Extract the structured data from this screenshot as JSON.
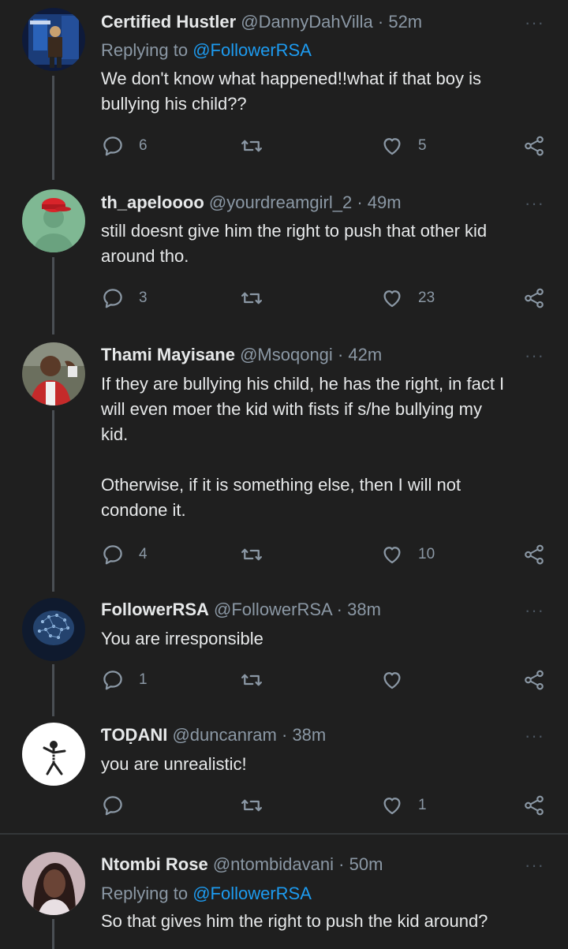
{
  "tweets": [
    {
      "name": "Certified Hustler",
      "handle": "@DannyDahVilla",
      "sep": "·",
      "time": "52m",
      "replying_prefix": "Replying to",
      "replying_to": "@FollowerRSA",
      "text": "We don't know what happened!!what if that boy is\nbullying his child??",
      "replies": "6",
      "retweets": "",
      "likes": "5"
    },
    {
      "name": "th_apeloooo",
      "handle": "@yourdreamgirl_2",
      "sep": "·",
      "time": "49m",
      "text": "still doesnt give him the right to push that other kid\naround tho.",
      "replies": "3",
      "retweets": "",
      "likes": "23"
    },
    {
      "name": "Thami Mayisane",
      "handle": "@Msoqongi",
      "sep": "·",
      "time": "42m",
      "text": "If they are bullying his child, he has the right, in fact I\nwill even moer the kid with fists if s/he bullying my\nkid.\n\nOtherwise, if it is something else, then I will not\ncondone it.",
      "replies": "4",
      "retweets": "",
      "likes": "10"
    },
    {
      "name": "FollowerRSA",
      "handle": "@FollowerRSA",
      "sep": "·",
      "time": "38m",
      "text": "You are irresponsible",
      "replies": "1",
      "retweets": "",
      "likes": ""
    },
    {
      "name": "ƬOḌANI",
      "handle": "@duncanram",
      "sep": "·",
      "time": "38m",
      "text": "you are unrealistic!",
      "replies": "",
      "retweets": "",
      "likes": "1"
    },
    {
      "name": "Ntombi Rose",
      "handle": "@ntombidavani",
      "sep": "·",
      "time": "50m",
      "replying_prefix": "Replying to",
      "replying_to": "@FollowerRSA",
      "text": "So that gives him the right to push the kid around?"
    }
  ],
  "icons": {
    "reply": "reply-icon",
    "retweet": "retweet-icon",
    "like": "heart-icon",
    "share": "share-icon",
    "more": "more-icon"
  },
  "more_glyph": "···",
  "colors": {
    "background": "#1f1f1f",
    "text": "#e7e9ea",
    "secondary": "#8b98a5",
    "link": "#1d9bf0",
    "thread_line": "#4a4f54"
  }
}
